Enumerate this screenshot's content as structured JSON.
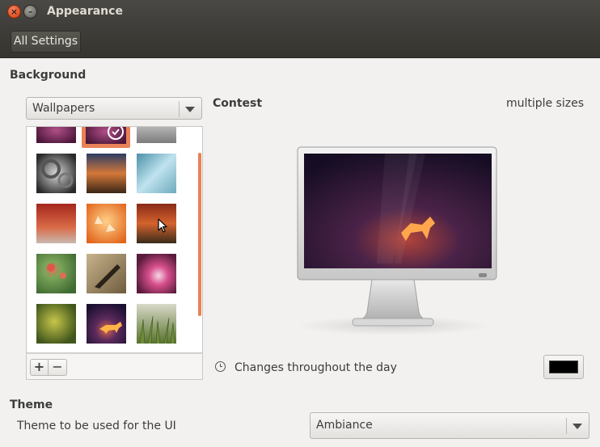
{
  "window": {
    "title": "Appearance"
  },
  "toolbar": {
    "all_settings_label": "All Settings"
  },
  "background": {
    "heading": "Background",
    "source_dropdown": {
      "selected": "Wallpapers"
    },
    "wallpaper_thumbnails": [
      "purple-abstract",
      "purple-selected",
      "grey-partial",
      "gears",
      "sunset-road",
      "blue-water",
      "red-autumn-path",
      "orange-leaves",
      "red-sunset-landscape",
      "red-poppy-flower",
      "fountain-pen",
      "pink-flower-macro",
      "green-bokeh-bud",
      "purple-cat-wallpaper",
      "green-grass"
    ],
    "list_buttons": {
      "add": "+",
      "remove": "−"
    },
    "preview": {
      "name": "Contest",
      "size": "multiple sizes"
    },
    "changes_label": "Changes throughout the day",
    "color": "#000000"
  },
  "theme": {
    "heading": "Theme",
    "label": "Theme to be used for the UI",
    "dropdown": {
      "selected": "Ambiance"
    }
  },
  "colors": {
    "accent_orange": "#e88256",
    "titlebar": "#3f3e3a"
  },
  "icons": [
    "close-icon",
    "minimize-icon",
    "chevron-down-icon",
    "clock-icon",
    "check-circle-icon",
    "mouse-pointer-icon"
  ]
}
